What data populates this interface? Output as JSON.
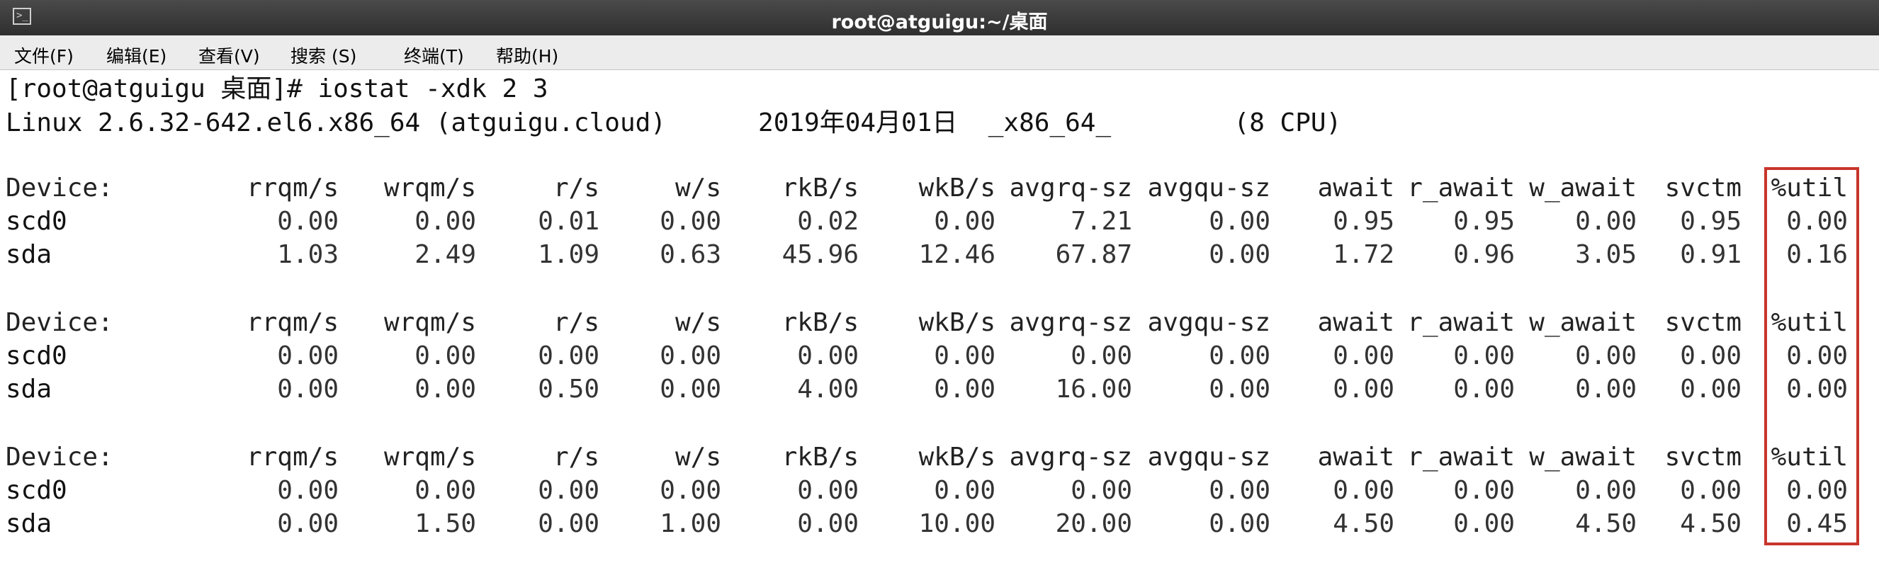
{
  "window": {
    "title": "root@atguigu:~/桌面",
    "icon": "terminal-icon"
  },
  "menu": [
    {
      "label": "文件(F)"
    },
    {
      "label": "编辑(E)"
    },
    {
      "label": "查看(V)"
    },
    {
      "label": "搜索 (S)"
    },
    {
      "label": "终端(T)"
    },
    {
      "label": "帮助(H)"
    }
  ],
  "terminal": {
    "prompt_line": "[root@atguigu 桌面]# iostat -xdk 2 3",
    "sysinfo_line": "Linux 2.6.32-642.el6.x86_64 (atguigu.cloud)      2019年04月01日  _x86_64_        (8 CPU)",
    "headers": [
      "Device:",
      "rrqm/s",
      "wrqm/s",
      "r/s",
      "w/s",
      "rkB/s",
      "wkB/s",
      "avgrq-sz",
      "avgqu-sz",
      "await",
      "r_await",
      "w_await",
      "svctm",
      "%util"
    ],
    "blocks": [
      {
        "rows": [
          [
            "scd0",
            "0.00",
            "0.00",
            "0.01",
            "0.00",
            "0.02",
            "0.00",
            "7.21",
            "0.00",
            "0.95",
            "0.95",
            "0.00",
            "0.95",
            "0.00"
          ],
          [
            "sda",
            "1.03",
            "2.49",
            "1.09",
            "0.63",
            "45.96",
            "12.46",
            "67.87",
            "0.00",
            "1.72",
            "0.96",
            "3.05",
            "0.91",
            "0.16"
          ]
        ]
      },
      {
        "rows": [
          [
            "scd0",
            "0.00",
            "0.00",
            "0.00",
            "0.00",
            "0.00",
            "0.00",
            "0.00",
            "0.00",
            "0.00",
            "0.00",
            "0.00",
            "0.00",
            "0.00"
          ],
          [
            "sda",
            "0.00",
            "0.00",
            "0.50",
            "0.00",
            "4.00",
            "0.00",
            "16.00",
            "0.00",
            "0.00",
            "0.00",
            "0.00",
            "0.00",
            "0.00"
          ]
        ]
      },
      {
        "rows": [
          [
            "scd0",
            "0.00",
            "0.00",
            "0.00",
            "0.00",
            "0.00",
            "0.00",
            "0.00",
            "0.00",
            "0.00",
            "0.00",
            "0.00",
            "0.00",
            "0.00"
          ],
          [
            "sda",
            "0.00",
            "1.50",
            "0.00",
            "1.00",
            "0.00",
            "10.00",
            "20.00",
            "0.00",
            "4.50",
            "0.00",
            "4.50",
            "4.50",
            "0.45"
          ]
        ]
      }
    ],
    "highlight_color": "#c8352a"
  }
}
